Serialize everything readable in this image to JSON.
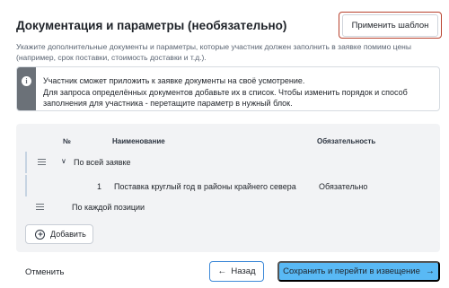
{
  "header": {
    "title": "Документация и параметры (необязательно)",
    "apply_template_label": "Применить шаблон"
  },
  "description": "Укажите дополнительные документы и параметры, которые участник должен заполнить в заявке помимо цены (например, срок поставки, стоимость доставки и т.д.).",
  "info": {
    "icon": "info-icon",
    "line1": "Участник сможет приложить к заявке документы на своё усмотрение.",
    "line2": "Для запроса определённых документов добавьте их в список. Чтобы изменить порядок и способ заполнения для участника - перетащите параметр в нужный блок."
  },
  "table": {
    "columns": {
      "number": "№",
      "name": "Наименование",
      "required": "Обязательность"
    },
    "groups": [
      {
        "label": "По всей заявке",
        "rows": [
          {
            "number": "1",
            "name": "Поставка круглый год в районы крайнего севера",
            "required": "Обязательно"
          }
        ]
      },
      {
        "label": "По каждой позиции",
        "rows": []
      }
    ],
    "add_label": "Добавить"
  },
  "footer": {
    "cancel_label": "Отменить",
    "back_label": "Назад",
    "save_label": "Сохранить и перейти в извещение"
  },
  "colors": {
    "accent": "#59b9f5",
    "accent_border": "#3f8ad8",
    "highlight_border": "#b8412d",
    "info_strip": "#6b7178",
    "panel_bg": "#f2f3f5"
  }
}
